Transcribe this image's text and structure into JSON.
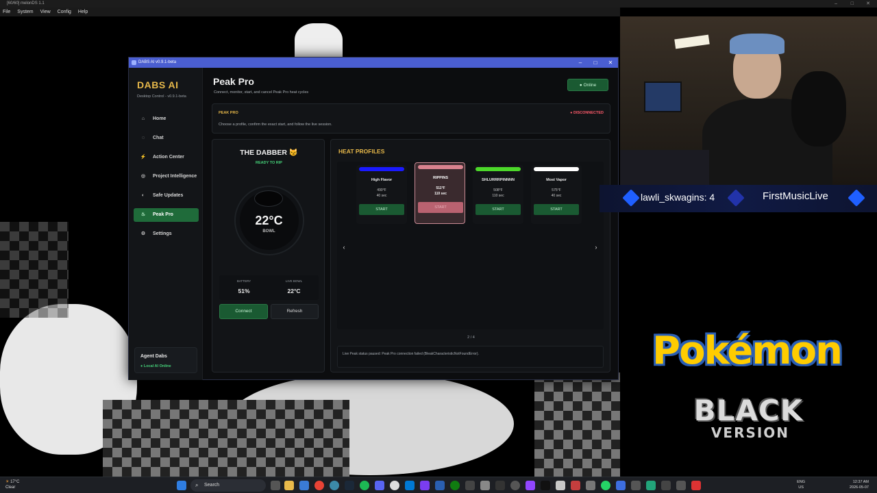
{
  "host": {
    "title": "[60/60] melonDS 1.1",
    "menu": [
      "File",
      "System",
      "View",
      "Config",
      "Help"
    ]
  },
  "app": {
    "window_title": "DABS AI v0.9.1-beta",
    "brand": "DABS AI",
    "brand_sub": "Desktop Control - v0.9.1-beta",
    "nav": [
      {
        "label": "Home",
        "icon": "home-icon",
        "glyph": "⌂"
      },
      {
        "label": "Chat",
        "icon": "chat-icon",
        "glyph": "◌"
      },
      {
        "label": "Action Center",
        "icon": "bolt-icon",
        "glyph": "⚡"
      },
      {
        "label": "Project Intelligence",
        "icon": "globe-icon",
        "glyph": "◎"
      },
      {
        "label": "Safe Updates",
        "icon": "shield-icon",
        "glyph": "◐"
      },
      {
        "label": "Peak Pro",
        "icon": "flame-icon",
        "glyph": "♨",
        "active": true
      },
      {
        "label": "Settings",
        "icon": "gear-icon",
        "glyph": "⚙"
      }
    ],
    "agent": {
      "title": "Agent Dabs",
      "status": "Local AI Online"
    },
    "page": {
      "title": "Peak Pro",
      "subtitle": "Connect, monitor, start, and cancel Peak Pro heat cycles",
      "online": "Online"
    },
    "banner": {
      "kicker": "PEAK PRO",
      "text": "Choose a profile, confirm the exact start, and follow the live session.",
      "status": "DISCONNECTED"
    },
    "device": {
      "name": "THE DABBER 😼",
      "state": "READY TO RIP",
      "bowl_temp": "22°C",
      "bowl_label": "BOWL",
      "battery_label": "BATTERY",
      "battery_value": "51%",
      "live_bowl_label": "LIVE BOWL",
      "live_bowl_value": "22°C",
      "connect": "Connect",
      "refresh": "Refresh"
    },
    "profiles": {
      "title": "HEAT PROFILES",
      "items": [
        {
          "name": "High Flavor",
          "temp": "490°F",
          "time": "40 sec",
          "start": "START",
          "color": "#1a1aff"
        },
        {
          "name": "RIPPINS",
          "temp": "511°F",
          "time": "110 sec",
          "start": "START",
          "color": "#d9828e",
          "selected": true
        },
        {
          "name": "SHLURRRPINNNN",
          "temp": "508°F",
          "time": "110 sec",
          "start": "START",
          "color": "#4cd82a"
        },
        {
          "name": "Most Vapor",
          "temp": "575°F",
          "time": "40 sec",
          "start": "START",
          "color": "#ffffff"
        }
      ],
      "page_count": "2 / 4",
      "live_status": "Live Peak status paused: Peak Pro connection failed (BleakCharacteristicNotFoundError)."
    }
  },
  "overlay": {
    "chat_left": "lawli_skwagins: 4",
    "chat_right": "FirstMusicLive",
    "game_logo": "Pokémon",
    "game_sub": "BLACK",
    "game_version": "VERSION"
  },
  "taskbar": {
    "weather_temp": "17°C",
    "weather_desc": "Clear",
    "search": "Search",
    "lang": "ENG",
    "region": "US",
    "time": "12:37 AM",
    "date": "2026-05-07"
  }
}
